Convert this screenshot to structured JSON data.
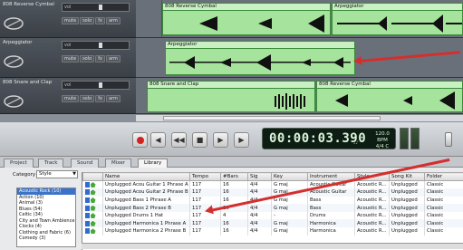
{
  "tracks": [
    {
      "name": "808 Reverse Cymbal",
      "clips": [
        {
          "title": "808 Reverse Cymbal"
        },
        {
          "title": "Arpeggiator"
        }
      ]
    },
    {
      "name": "Arpeggiator",
      "clips": [
        {
          "title": "Arpeggiator"
        }
      ]
    },
    {
      "name": "808 Snare and Clap",
      "clips": [
        {
          "title": "808 Snare and Clap"
        },
        {
          "title": "808 Reverse Cymbal"
        }
      ]
    }
  ],
  "track_buttons": {
    "mute": "mute",
    "solo": "solo",
    "fx": "fx",
    "arm": "arm"
  },
  "transport": {
    "time": "00:00:03.390",
    "bpm": "120.0 BPM",
    "sig": "4/4",
    "key": "C"
  },
  "tabs": [
    "Project",
    "Track",
    "Sound",
    "Mixer",
    "Library"
  ],
  "active_tab": "Library",
  "browser": {
    "category_label": "Category",
    "category_value": "Style",
    "categories": [
      "Acoustic Rock (10)",
      "Action (10)",
      "Animal (3)",
      "Blues (54)",
      "Celtic (34)",
      "City and Town Ambience",
      "Clocks (4)",
      "Clothing and Fabric (6)",
      "Comedy (3)"
    ],
    "selected_category_index": 0,
    "columns": [
      "",
      "Name",
      "Tempo",
      "#Bars",
      "Sig",
      "Key",
      "Instrument",
      "Style",
      "Song Kit",
      "Folder"
    ],
    "rows": [
      [
        "Unplugged Acou Guitar 1 Phrase A",
        "117",
        "16",
        "4/4",
        "G maj",
        "Acoustic Guitar",
        "Acoustic R...",
        "Unplugged",
        "Classic"
      ],
      [
        "Unplugged Acou Guitar 2 Phrase B",
        "117",
        "16",
        "4/4",
        "G maj",
        "Acoustic Guitar",
        "Acoustic R...",
        "Unplugged",
        "Classic"
      ],
      [
        "Unplugged Bass 1 Phrase A",
        "117",
        "16",
        "4/4",
        "G maj",
        "Bass",
        "Acoustic R...",
        "Unplugged",
        "Classic"
      ],
      [
        "Unplugged Bass 2 Phrase B",
        "117",
        "16",
        "4/4",
        "G maj",
        "Bass",
        "Acoustic R...",
        "Unplugged",
        "Classic"
      ],
      [
        "Unplugged Drums 1 Hat",
        "117",
        "4",
        "4/4",
        "-",
        "Drums",
        "Acoustic R...",
        "Unplugged",
        "Classic"
      ],
      [
        "Unplugged Harmonica 1 Phrase A",
        "117",
        "16",
        "4/4",
        "G maj",
        "Harmonica",
        "Acoustic R...",
        "Unplugged",
        "Classic"
      ],
      [
        "Unplugged Harmonica 2 Phrase B",
        "117",
        "16",
        "4/4",
        "G maj",
        "Harmonica",
        "Acoustic R...",
        "Unplugged",
        "Classic"
      ]
    ]
  },
  "colors": {
    "clip_fill": "#a6e39c",
    "clip_border": "#3a8a3a",
    "annotation_arrow": "#d32f2f",
    "selection": "#3b73c9"
  }
}
